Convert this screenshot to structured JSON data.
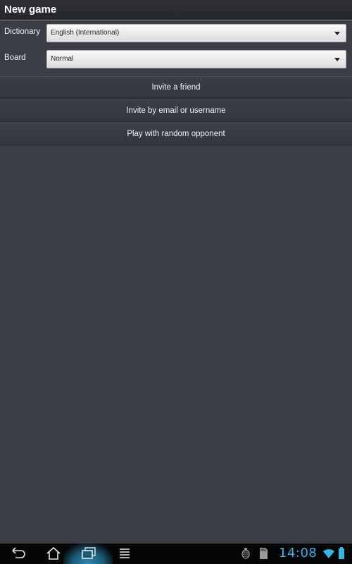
{
  "header": {
    "title": "New game"
  },
  "form": {
    "dictionary": {
      "label": "Dictionary",
      "value": "English (International)"
    },
    "board": {
      "label": "Board",
      "value": "Normal"
    }
  },
  "actions": [
    {
      "label": "Invite a friend"
    },
    {
      "label": "Invite by email or username"
    },
    {
      "label": "Play with random opponent"
    }
  ],
  "system_bar": {
    "nav_icons": [
      "back-icon",
      "home-icon",
      "recent-apps-icon",
      "menu-icon"
    ],
    "status_icons": [
      "debug-icon",
      "sd-card-icon",
      "wifi-icon",
      "battery-icon"
    ],
    "time": "14:08",
    "accent_color": "#33b5e5"
  }
}
